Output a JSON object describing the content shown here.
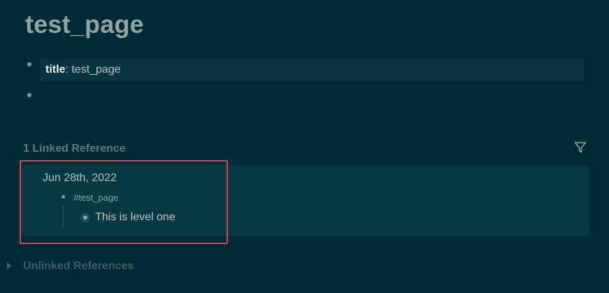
{
  "page": {
    "title": "test_page"
  },
  "properties": {
    "key": "title",
    "separator": ": ",
    "value": "test_page"
  },
  "linked_references": {
    "heading": "1 Linked Reference",
    "filter_icon": "filter-icon",
    "reference": {
      "date": "Jun 28th, 2022",
      "tag": "#test_page",
      "child_text": "This is level one"
    }
  },
  "unlinked_references": {
    "heading": "Unlinked References"
  },
  "colors": {
    "background": "#002b36",
    "panel": "#083842",
    "highlight": "#e0424a"
  }
}
